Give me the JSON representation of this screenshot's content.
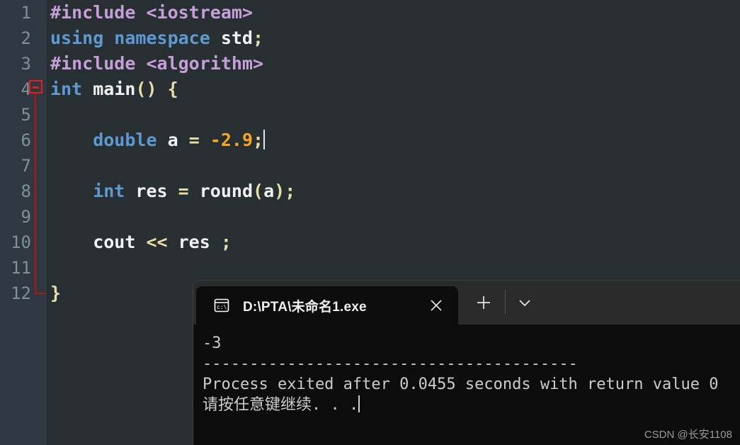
{
  "editor": {
    "background": "#282f32",
    "gutter_background": "#2f3740",
    "line_number_color": "#7d9199",
    "fold_marker_color": "#e02020",
    "lines": [
      {
        "n": "1",
        "tokens": [
          {
            "t": "#include <iostream>",
            "c": "t-pre"
          }
        ]
      },
      {
        "n": "2",
        "tokens": [
          {
            "t": "using namespace ",
            "c": "t-kw"
          },
          {
            "t": "std",
            "c": "t-id"
          },
          {
            "t": ";",
            "c": "t-punc"
          }
        ]
      },
      {
        "n": "3",
        "tokens": [
          {
            "t": "#include <algorithm>",
            "c": "t-pre"
          }
        ]
      },
      {
        "n": "4",
        "tokens": [
          {
            "t": "int ",
            "c": "t-kw"
          },
          {
            "t": "main",
            "c": "t-id"
          },
          {
            "t": "() {",
            "c": "t-punc"
          }
        ]
      },
      {
        "n": "5",
        "tokens": []
      },
      {
        "n": "6",
        "tokens": [
          {
            "t": "    double ",
            "c": "t-kw"
          },
          {
            "t": "a ",
            "c": "t-id"
          },
          {
            "t": "= ",
            "c": "t-punc"
          },
          {
            "t": "-2.9",
            "c": "t-num"
          },
          {
            "t": ";",
            "c": "t-punc"
          },
          {
            "t": "|CARET|",
            "c": "caret"
          }
        ]
      },
      {
        "n": "7",
        "tokens": []
      },
      {
        "n": "8",
        "tokens": [
          {
            "t": "    int ",
            "c": "t-kw"
          },
          {
            "t": "res ",
            "c": "t-id"
          },
          {
            "t": "= ",
            "c": "t-punc"
          },
          {
            "t": "round",
            "c": "t-id"
          },
          {
            "t": "(",
            "c": "t-punc"
          },
          {
            "t": "a",
            "c": "t-id"
          },
          {
            "t": ");",
            "c": "t-punc"
          }
        ]
      },
      {
        "n": "9",
        "tokens": []
      },
      {
        "n": "10",
        "tokens": [
          {
            "t": "    cout ",
            "c": "t-id"
          },
          {
            "t": "<< ",
            "c": "t-punc"
          },
          {
            "t": "res ",
            "c": "t-id"
          },
          {
            "t": ";",
            "c": "t-punc"
          }
        ]
      },
      {
        "n": "11",
        "tokens": []
      },
      {
        "n": "12",
        "tokens": [
          {
            "t": "}",
            "c": "t-punc"
          }
        ]
      }
    ]
  },
  "terminal": {
    "background": "#0c0c0c",
    "tabstrip_background": "#2b2b2b",
    "tab": {
      "icon": "console-cmd-icon",
      "icon_label": "c:\\",
      "title": "D:\\PTA\\未命名1.exe",
      "close_icon": "close-icon",
      "new_tab_icon": "plus-icon",
      "dropdown_icon": "chevron-down-icon"
    },
    "output": [
      "-3",
      "----------------------------------------",
      "Process exited after 0.0455 seconds with return value 0",
      "请按任意键继续. . ."
    ]
  },
  "watermark": {
    "text": "CSDN @长安1108"
  }
}
